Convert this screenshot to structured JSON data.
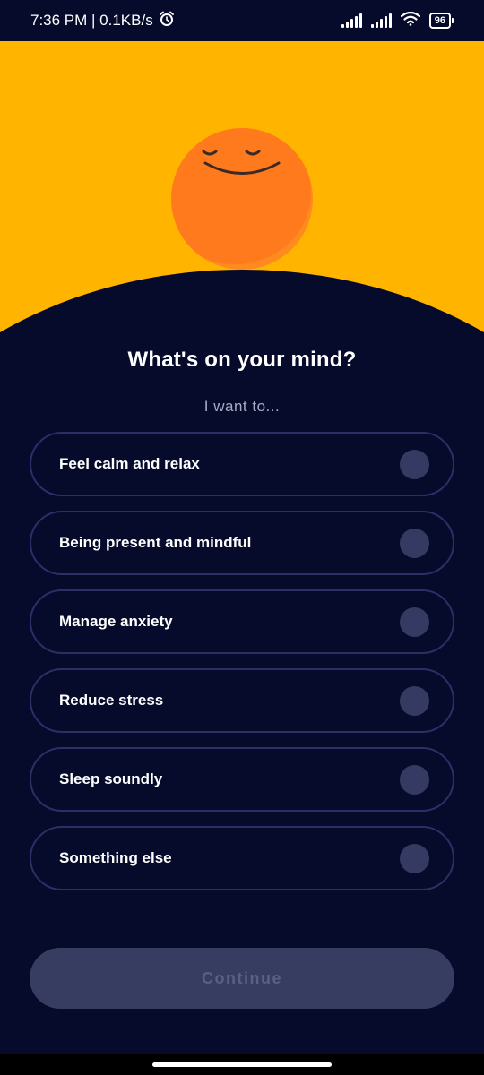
{
  "status_bar": {
    "time_speed": "7:36 PM | 0.1KB/s",
    "alarm_icon": "alarm-clock-icon",
    "battery_level": "96"
  },
  "colors": {
    "hero_bg": "#ffb400",
    "sun": "#ff8a1f",
    "page_bg": "#060a2b",
    "option_border": "#2b2f66",
    "radio_fill": "#353a62",
    "button_disabled": "#373c61"
  },
  "main": {
    "title": "What's on your mind?",
    "subtitle": "I want to...",
    "options": [
      {
        "label": "Feel calm and relax"
      },
      {
        "label": "Being present and mindful"
      },
      {
        "label": "Manage anxiety"
      },
      {
        "label": "Reduce stress"
      },
      {
        "label": "Sleep soundly"
      },
      {
        "label": "Something else"
      }
    ],
    "continue_label": "Continue"
  }
}
